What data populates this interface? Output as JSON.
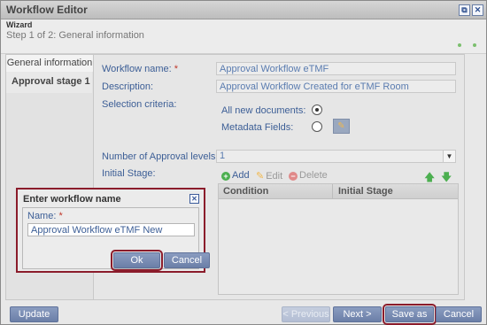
{
  "window": {
    "title": "Workflow Editor"
  },
  "wizard": {
    "label": "Wizard",
    "step": "Step 1 of 2: General information"
  },
  "sidebar": {
    "tab": "General information",
    "items": [
      {
        "label": "Approval stage 1"
      }
    ]
  },
  "form": {
    "name_label": "Workflow name:",
    "name_value": "Approval Workflow eTMF",
    "desc_label": "Description:",
    "desc_value": "Approval Workflow Created for eTMF Room",
    "criteria_label": "Selection criteria:",
    "all_docs_label": "All new documents:",
    "metadata_label": "Metadata Fields:",
    "levels_label": "Number of Approval levels:",
    "levels_value": "1",
    "initial_stage_label": "Initial Stage:"
  },
  "grid": {
    "toolbar": {
      "add": "Add",
      "edit": "Edit",
      "delete": "Delete"
    },
    "columns": [
      "Condition",
      "Initial Stage"
    ]
  },
  "dialog": {
    "title": "Enter workflow name",
    "name_label": "Name:",
    "name_value": "Approval Workflow eTMF New",
    "ok": "Ok",
    "cancel": "Cancel"
  },
  "footer": {
    "update": "Update",
    "previous": "< Previous",
    "next": "Next >",
    "save_as": "Save as",
    "cancel": "Cancel"
  },
  "colors": {
    "accent": "#6b7fa8",
    "highlight": "#8b1c2b",
    "label_blue": "#3c5e96"
  }
}
